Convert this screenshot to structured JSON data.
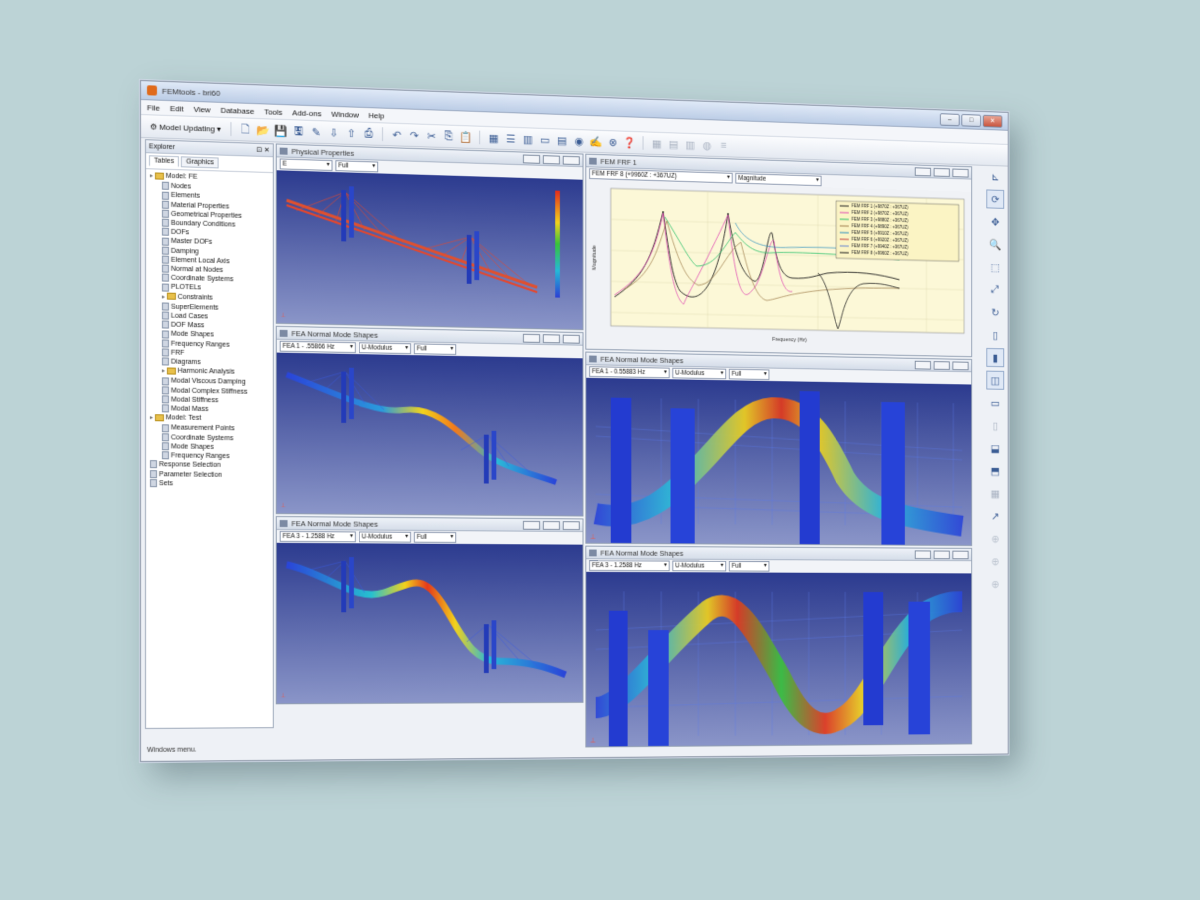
{
  "window": {
    "title": "FEMtools - bri60",
    "buttons": [
      "–",
      "□",
      "✕"
    ]
  },
  "menu": [
    "File",
    "Edit",
    "View",
    "Database",
    "Tools",
    "Add-ons",
    "Window",
    "Help"
  ],
  "toolbar": {
    "model_update_label": "Model Updating",
    "icons": [
      "new-icon",
      "open-icon",
      "save-icon",
      "print-icon",
      "undo-icon",
      "redo-icon",
      "cut-icon",
      "copy-icon",
      "paste-icon"
    ]
  },
  "explorer": {
    "title": "Explorer",
    "tabs": [
      "Tables",
      "Graphics"
    ],
    "tree": [
      {
        "label": "Model: FE",
        "level": 0,
        "folder": true
      },
      {
        "label": "Nodes",
        "level": 1
      },
      {
        "label": "Elements",
        "level": 1
      },
      {
        "label": "Material Properties",
        "level": 1
      },
      {
        "label": "Geometrical Properties",
        "level": 1
      },
      {
        "label": "Boundary Conditions",
        "level": 1
      },
      {
        "label": "DOFs",
        "level": 1
      },
      {
        "label": "Master DOFs",
        "level": 1
      },
      {
        "label": "Damping",
        "level": 1
      },
      {
        "label": "Element Local Axis",
        "level": 1
      },
      {
        "label": "Normal at Nodes",
        "level": 1
      },
      {
        "label": "Coordinate Systems",
        "level": 1
      },
      {
        "label": "PLOTELs",
        "level": 1
      },
      {
        "label": "Constraints",
        "level": 1,
        "folder": true
      },
      {
        "label": "SuperElements",
        "level": 1
      },
      {
        "label": "Load Cases",
        "level": 1
      },
      {
        "label": "DOF Mass",
        "level": 1
      },
      {
        "label": "Mode Shapes",
        "level": 1
      },
      {
        "label": "Frequency Ranges",
        "level": 1
      },
      {
        "label": "FRF",
        "level": 1
      },
      {
        "label": "Diagrams",
        "level": 1
      },
      {
        "label": "Harmonic Analysis",
        "level": 1,
        "folder": true
      },
      {
        "label": "Modal Viscous Damping",
        "level": 1
      },
      {
        "label": "Modal Complex Stiffness",
        "level": 1
      },
      {
        "label": "Modal Stiffness",
        "level": 1
      },
      {
        "label": "Modal Mass",
        "level": 1
      },
      {
        "label": "Model: Test",
        "level": 0,
        "folder": true
      },
      {
        "label": "Measurement Points",
        "level": 1
      },
      {
        "label": "Coordinate Systems",
        "level": 1
      },
      {
        "label": "Mode Shapes",
        "level": 1
      },
      {
        "label": "Frequency Ranges",
        "level": 1
      },
      {
        "label": "Response Selection",
        "level": 0
      },
      {
        "label": "Parameter Selection",
        "level": 0
      },
      {
        "label": "Sets",
        "level": 0
      }
    ],
    "status": "Windows menu."
  },
  "panels": {
    "physical": {
      "title": "Physical Properties",
      "combos": [
        "E",
        "Full"
      ]
    },
    "frf": {
      "title": "FEM FRF 1",
      "combos": [
        "FEM FRF 8 (+9960Z : +367UZ)",
        "Magnitude"
      ],
      "legend": [
        "FEM FRF 1 (+9870Z : +367UZ)",
        "FEM FRF 2 (+9870Z : +367UZ)",
        "FEM FRF 3 (+9880Z : +367UZ)",
        "FEM FRF 4 (+9890Z : +367UZ)",
        "FEM FRF 5 (+9910Z : +367UZ)",
        "FEM FRF 6 (+9920Z : +367UZ)",
        "FEM FRF 7 (+9940Z : +367UZ)",
        "FEM FRF 8 (+9960Z : +367UZ)"
      ],
      "xlabel": "Frequency (Hz)",
      "ylabel": "Magnitude"
    },
    "mode1": {
      "title": "FEA Normal Mode Shapes",
      "combos": [
        "FEA 1 - .55866 Hz",
        "U-Modulus",
        "Full"
      ]
    },
    "mode2": {
      "title": "FEA Normal Mode Shapes",
      "combos": [
        "FEA 1 - 0.55883 Hz",
        "U-Modulus",
        "Full"
      ]
    },
    "mode3": {
      "title": "FEA Normal Mode Shapes",
      "combos": [
        "FEA 3 - 1.2588 Hz",
        "U-Modulus",
        "Full"
      ]
    },
    "mode4": {
      "title": "FEA Normal Mode Shapes",
      "combos": [
        "FEA 3 - 1.2588 Hz",
        "U-Modulus",
        "Full"
      ]
    }
  },
  "colors": {
    "background": "#bcd3d6",
    "viewport_top": "#2c3b8f",
    "viewport_bottom": "#8a95c8",
    "plot_bg": "#fcf8d7"
  }
}
